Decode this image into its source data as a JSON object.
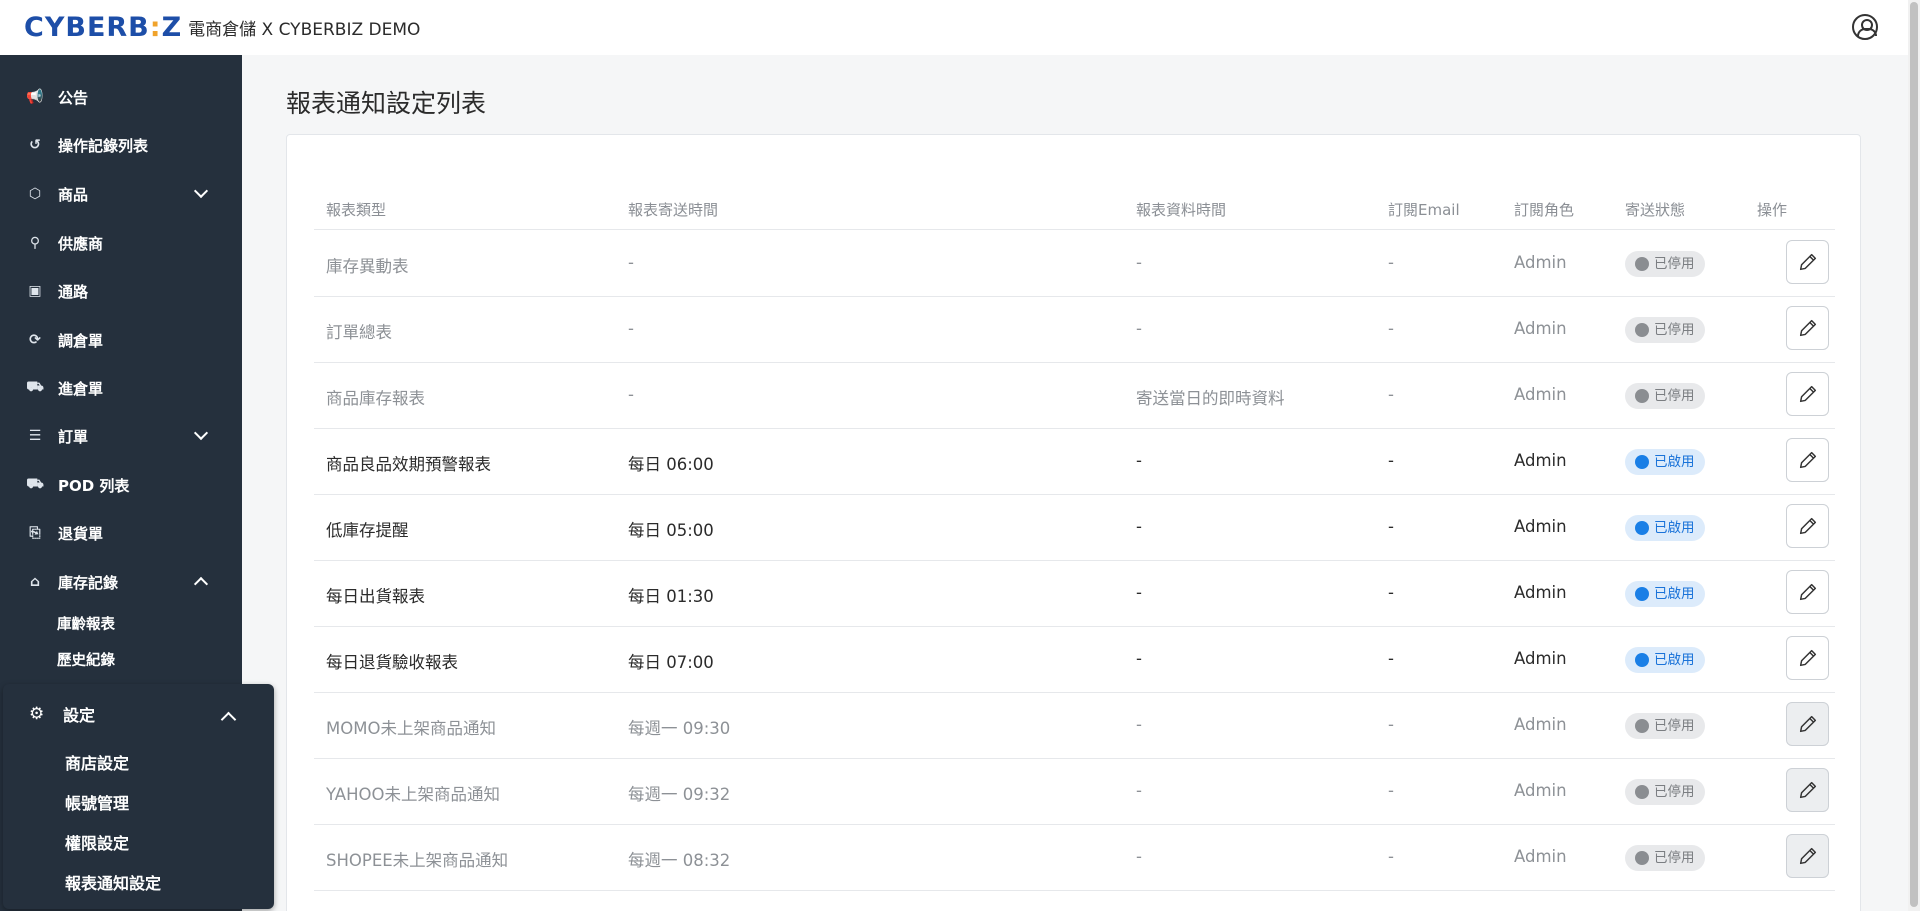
{
  "header": {
    "logo_text": "CYBERB",
    "logo_dot": ":",
    "logo_end": "Z",
    "subtitle": "電商倉儲 X CYBERBIZ DEMO"
  },
  "sidebar": {
    "items": [
      {
        "label": "公告",
        "icon": "megaphone-icon",
        "glyph": "📢"
      },
      {
        "label": "操作記錄列表",
        "icon": "history-icon",
        "glyph": "↺"
      },
      {
        "label": "商品",
        "icon": "package-icon",
        "glyph": "⬡"
      },
      {
        "label": "供應商",
        "icon": "supplier-icon",
        "glyph": "⚲"
      },
      {
        "label": "通路",
        "icon": "store-icon",
        "glyph": "▣"
      },
      {
        "label": "調倉單",
        "icon": "transfer-icon",
        "glyph": "⟳"
      },
      {
        "label": "進倉單",
        "icon": "inbound-icon",
        "glyph": "⛟"
      },
      {
        "label": "訂單",
        "icon": "list-icon",
        "glyph": "☰"
      },
      {
        "label": "POD 列表",
        "icon": "truck-icon",
        "glyph": "⛟"
      },
      {
        "label": "退貨單",
        "icon": "return-icon",
        "glyph": "⎘"
      },
      {
        "label": "庫存記錄",
        "icon": "warehouse-icon",
        "glyph": "⌂"
      }
    ],
    "inventory_sub": [
      "庫齡報表",
      "歷史紀錄"
    ],
    "settings": {
      "label": "設定",
      "sub": [
        "商店設定",
        "帳號管理",
        "權限設定",
        "報表通知設定"
      ]
    }
  },
  "page": {
    "title": "報表通知設定列表"
  },
  "table": {
    "headers": [
      "報表類型",
      "報表寄送時間",
      "報表資料時間",
      "訂閱Email",
      "訂閱角色",
      "寄送狀態",
      "操作"
    ],
    "rows": [
      {
        "type": "庫存異動表",
        "send_time": "-",
        "data_time": "-",
        "email": "-",
        "role": "Admin",
        "status": "已停用",
        "enabled": false,
        "edit_disabled": false
      },
      {
        "type": "訂單總表",
        "send_time": "-",
        "data_time": "-",
        "email": "-",
        "role": "Admin",
        "status": "已停用",
        "enabled": false,
        "edit_disabled": false
      },
      {
        "type": "商品庫存報表",
        "send_time": "-",
        "data_time": "寄送當日的即時資料",
        "email": "-",
        "role": "Admin",
        "status": "已停用",
        "enabled": false,
        "edit_disabled": false
      },
      {
        "type": "商品良品效期預警報表",
        "send_time": "每日 06:00",
        "data_time": "-",
        "email": "-",
        "role": "Admin",
        "status": "已啟用",
        "enabled": true,
        "edit_disabled": false
      },
      {
        "type": "低庫存提醒",
        "send_time": "每日 05:00",
        "data_time": "-",
        "email": "-",
        "role": "Admin",
        "status": "已啟用",
        "enabled": true,
        "edit_disabled": false
      },
      {
        "type": "每日出貨報表",
        "send_time": "每日 01:30",
        "data_time": "-",
        "email": "-",
        "role": "Admin",
        "status": "已啟用",
        "enabled": true,
        "edit_disabled": false
      },
      {
        "type": "每日退貨驗收報表",
        "send_time": "每日 07:00",
        "data_time": "-",
        "email": "-",
        "role": "Admin",
        "status": "已啟用",
        "enabled": true,
        "edit_disabled": false
      },
      {
        "type": "MOMO未上架商品通知",
        "send_time": "每週一 09:30",
        "data_time": "-",
        "email": "-",
        "role": "Admin",
        "status": "已停用",
        "enabled": false,
        "edit_disabled": true
      },
      {
        "type": "YAHOO未上架商品通知",
        "send_time": "每週一 09:32",
        "data_time": "-",
        "email": "-",
        "role": "Admin",
        "status": "已停用",
        "enabled": false,
        "edit_disabled": true
      },
      {
        "type": "SHOPEE未上架商品通知",
        "send_time": "每週一 08:32",
        "data_time": "-",
        "email": "-",
        "role": "Admin",
        "status": "已停用",
        "enabled": false,
        "edit_disabled": true
      }
    ]
  },
  "colors": {
    "sidebar_bg": "#25303d",
    "brand_blue": "#1d4ea8",
    "enabled_blue": "#1a7fe6",
    "disabled_gray": "#8a8d91"
  }
}
